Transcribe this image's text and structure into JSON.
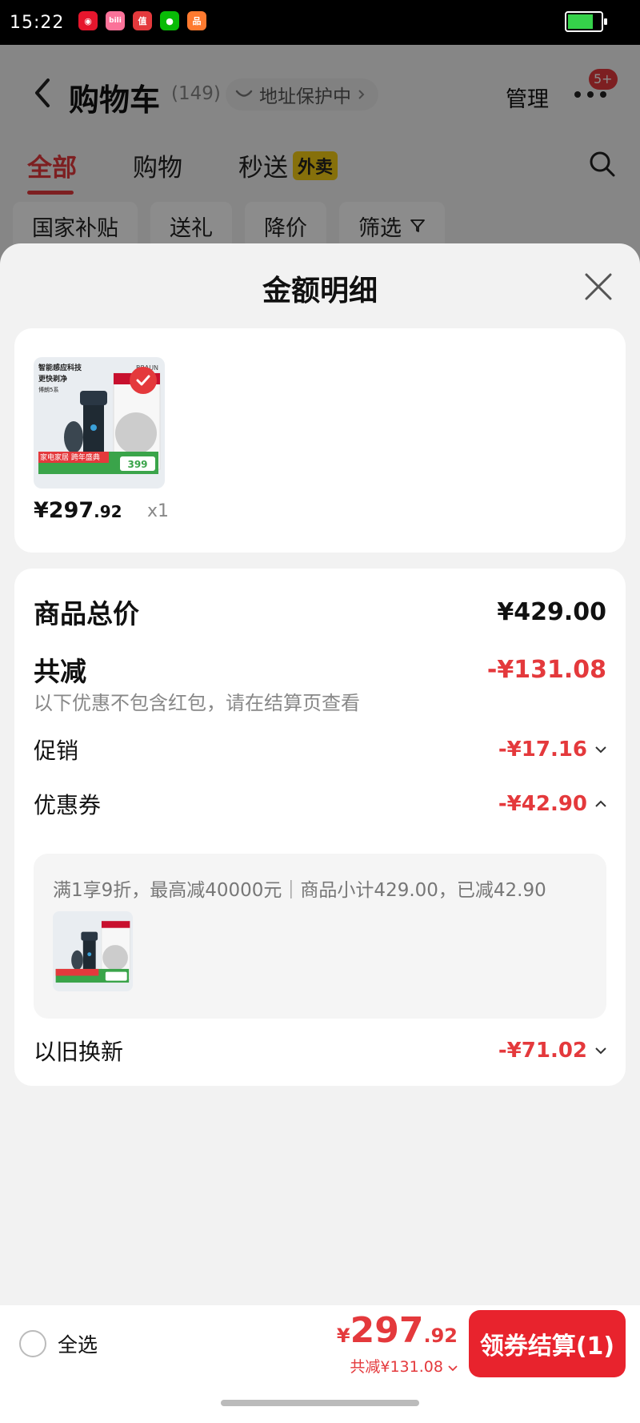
{
  "status_bar": {
    "time": "15:22",
    "apps": [
      "weibo",
      "bilibili",
      "zhi",
      "wechat",
      "app"
    ]
  },
  "cart": {
    "title": "购物车",
    "count": "(149)",
    "address_protect": "地址保护中",
    "manage": "管理",
    "badge": "5+",
    "tabs": [
      {
        "label": "全部",
        "active": true
      },
      {
        "label": "购物",
        "active": false
      },
      {
        "label": "秒送",
        "tag": "外卖",
        "active": false
      }
    ],
    "chips": [
      "国家补贴",
      "送礼",
      "降价",
      "筛选"
    ]
  },
  "sheet": {
    "title": "金额明细",
    "product": {
      "image_text_line1": "智能感应科技",
      "image_text_line2": "更快剃净",
      "image_text_line3": "博朗5系",
      "image_brand": "BRAUN",
      "image_promo": "家电家居 跨年盛典",
      "image_price": "399",
      "price_int": "¥297",
      "price_dec": ".92",
      "qty": "x1"
    },
    "breakdown": {
      "total_label": "商品总价",
      "total_value": "¥429.00",
      "reduced_label": "共减",
      "reduced_value": "-¥131.08",
      "note": "以下优惠不包含红包，请在结算页查看",
      "promo_label": "促销",
      "promo_value": "-¥17.16",
      "coupon_label": "优惠券",
      "coupon_value": "-¥42.90",
      "coupon_detail": "满1享9折，最高减40000元｜商品小计429.00，已减42.90",
      "tradein_label": "以旧换新",
      "tradein_value": "-¥71.02"
    }
  },
  "bottom": {
    "select_all": "全选",
    "currency": "¥",
    "price_int": "297",
    "price_dec": ".92",
    "saved": "共减¥131.08",
    "checkout": "领券结算(1)"
  },
  "colors": {
    "accent": "#e4393c",
    "tag_yellow": "#f5cd15",
    "battery": "#35d24a"
  }
}
